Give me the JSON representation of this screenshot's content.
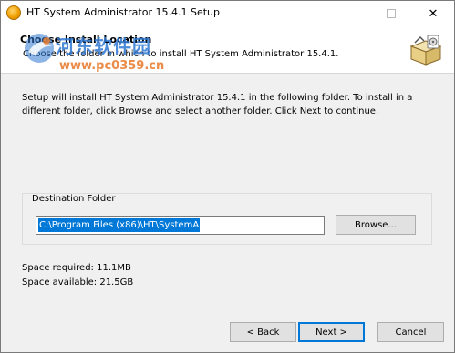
{
  "window": {
    "title": "HT System Administrator 15.4.1 Setup",
    "close_glyph": "✕"
  },
  "header": {
    "title": "Choose Install Location",
    "subtitle": "Choose the folder in which to install HT System Administrator 15.4.1."
  },
  "watermark": {
    "text": "河东软件园",
    "url": "www.pc0359.cn"
  },
  "body": {
    "intro": "Setup will install HT System Administrator 15.4.1 in the following folder. To install in a different folder, click Browse and select another folder. Click Next to continue."
  },
  "destination": {
    "legend": "Destination Folder",
    "path": "C:\\Program Files (x86)\\HT\\SystemA",
    "browse_label": "Browse..."
  },
  "space": {
    "required": "Space required: 11.1MB",
    "available": "Space available: 21.5GB"
  },
  "footer": {
    "brand": "",
    "back_label": "< Back",
    "next_label": "Next >",
    "cancel_label": "Cancel"
  },
  "icons": {
    "app": "installer-app-icon",
    "header": "install-box-icon"
  },
  "colors": {
    "selection": "#0078d7",
    "titlebar_bg": "#ffffff",
    "dialog_bg": "#f0f0f0"
  }
}
